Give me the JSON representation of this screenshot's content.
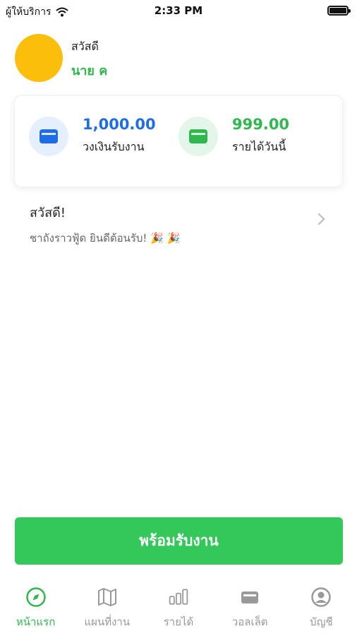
{
  "status_bar": {
    "carrier": "ผู้ให้บริการ",
    "time": "2:33 PM"
  },
  "profile": {
    "greeting": "สวัสดี",
    "name": "นาย ค",
    "avatar_color": "#fbbf0b"
  },
  "stats": {
    "credit": {
      "value": "1,000.00",
      "label": "วงเงินรับงาน",
      "color": "#1f6ce8",
      "icon": "wallet-icon"
    },
    "income": {
      "value": "999.00",
      "label": "รายได้วันนี้",
      "color": "#2fb84d",
      "icon": "wallet-icon"
    }
  },
  "welcome": {
    "title": "สวัสดี!",
    "subtitle": "ชาถังราวฟู้ด ยินดีต้อนรับ! 🎉 🎉"
  },
  "ready_button": {
    "label": "พร้อมรับงาน",
    "color": "#34c759"
  },
  "tabs": [
    {
      "label": "หน้าแรก",
      "icon": "compass-icon",
      "active": true
    },
    {
      "label": "แผนที่งาน",
      "icon": "map-icon",
      "active": false
    },
    {
      "label": "รายได้",
      "icon": "bar-chart-icon",
      "active": false
    },
    {
      "label": "วอลเล็ต",
      "icon": "wallet-icon",
      "active": false
    },
    {
      "label": "บัญชี",
      "icon": "account-icon",
      "active": false
    }
  ]
}
